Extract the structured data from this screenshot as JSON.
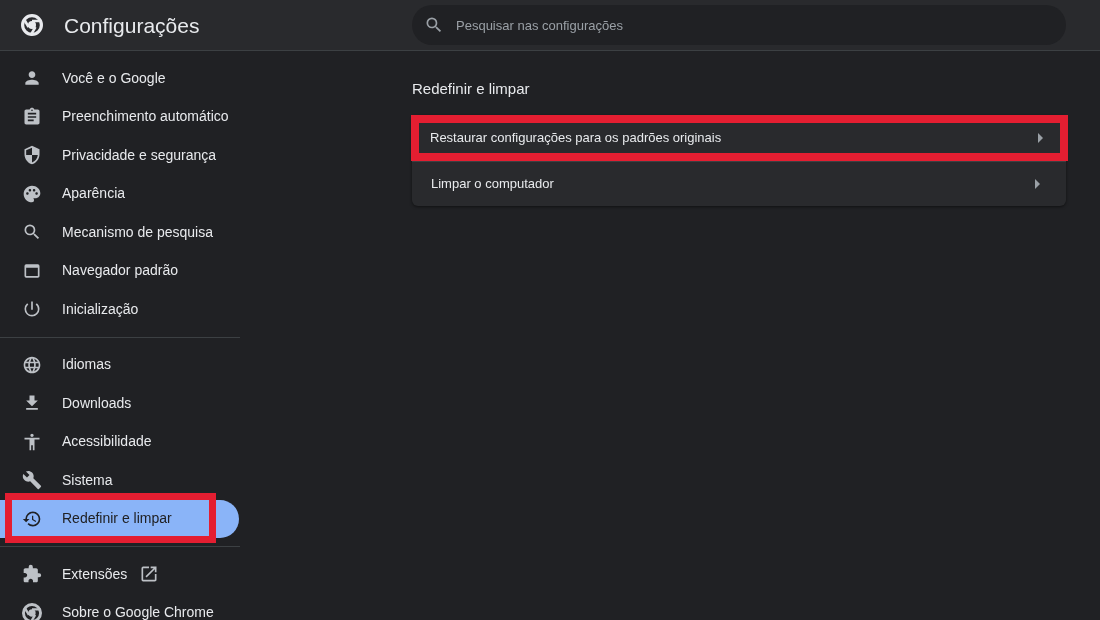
{
  "header": {
    "title": "Configurações",
    "search": {
      "placeholder": "Pesquisar nas configurações"
    }
  },
  "sidebar": {
    "groups": [
      {
        "items": [
          {
            "label": "Você e o Google",
            "selected": false,
            "highlighted": false,
            "external": false
          },
          {
            "label": "Preenchimento automático",
            "selected": false,
            "highlighted": false,
            "external": false
          },
          {
            "label": "Privacidade e segurança",
            "selected": false,
            "highlighted": false,
            "external": false
          },
          {
            "label": "Aparência",
            "selected": false,
            "highlighted": false,
            "external": false
          },
          {
            "label": "Mecanismo de pesquisa",
            "selected": false,
            "highlighted": false,
            "external": false
          },
          {
            "label": "Navegador padrão",
            "selected": false,
            "highlighted": false,
            "external": false
          },
          {
            "label": "Inicialização",
            "selected": false,
            "highlighted": false,
            "external": false
          }
        ]
      },
      {
        "items": [
          {
            "label": "Idiomas",
            "selected": false,
            "highlighted": false,
            "external": false
          },
          {
            "label": "Downloads",
            "selected": false,
            "highlighted": false,
            "external": false
          },
          {
            "label": "Acessibilidade",
            "selected": false,
            "highlighted": false,
            "external": false
          },
          {
            "label": "Sistema",
            "selected": false,
            "highlighted": false,
            "external": false
          },
          {
            "label": "Redefinir e limpar",
            "selected": true,
            "highlighted": true,
            "external": false
          }
        ]
      },
      {
        "items": [
          {
            "label": "Extensões",
            "selected": false,
            "highlighted": false,
            "external": true
          },
          {
            "label": "Sobre o Google Chrome",
            "selected": false,
            "highlighted": false,
            "external": false
          }
        ]
      }
    ]
  },
  "main": {
    "section_title": "Redefinir e limpar",
    "rows": [
      {
        "label": "Restaurar configurações para os padrões originais",
        "highlighted": true
      },
      {
        "label": "Limpar o computador",
        "highlighted": false
      }
    ]
  }
}
